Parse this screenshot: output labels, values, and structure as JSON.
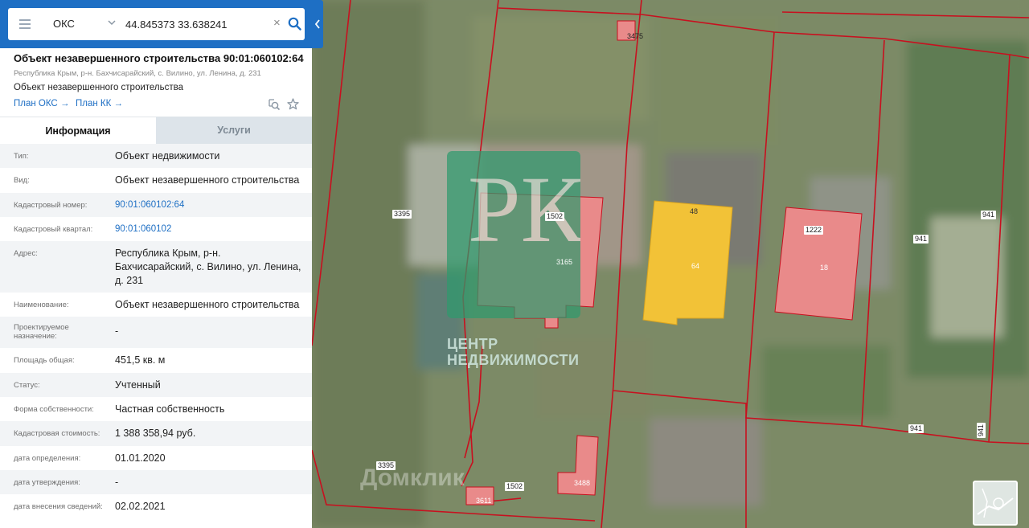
{
  "search": {
    "type_label": "ОКС",
    "query_value": "44.845373 33.638241",
    "clear_glyph": "×"
  },
  "object": {
    "title": "Объект незавершенного строительства 90:01:060102:64",
    "address_line": "Республика Крым, р-н. Бахчисарайский, с. Вилино, ул. Ленина, д. 231",
    "type_line": "Объект незавершенного строительства",
    "links": {
      "plan_oks": "План ОКС",
      "plan_kk": "План КК",
      "arrow": "→"
    }
  },
  "tabs": [
    {
      "label": "Информация",
      "active": true
    },
    {
      "label": "Услуги",
      "active": false
    }
  ],
  "info_rows": [
    {
      "key": "Тип:",
      "value": "Объект недвижимости"
    },
    {
      "key": "Вид:",
      "value": "Объект незавершенного строительства"
    },
    {
      "key": "Кадастровый номер:",
      "value": "90:01:060102:64",
      "link": true
    },
    {
      "key": "Кадастровый квартал:",
      "value": "90:01:060102",
      "link": true
    },
    {
      "key": "Адрес:",
      "value": "Республика Крым, р-н. Бахчисарайский, с. Вилино, ул. Ленина, д. 231"
    },
    {
      "key": "Наименование:",
      "value": "Объект незавершенного строительства"
    },
    {
      "key": "Проектируемое назначение:",
      "value": "-"
    },
    {
      "key": "Площадь общая:",
      "value": "451,5 кв. м"
    },
    {
      "key": "Статус:",
      "value": "Учтенный"
    },
    {
      "key": "Форма собственности:",
      "value": "Частная собственность"
    },
    {
      "key": "Кадастровая стоимость:",
      "value": "1 388 358,94 руб."
    },
    {
      "key": "дата определения:",
      "value": "01.01.2020"
    },
    {
      "key": "дата утверждения:",
      "value": "-"
    },
    {
      "key": "дата внесения сведений:",
      "value": "02.02.2021"
    }
  ],
  "map": {
    "parcel_labels": [
      "3395",
      "3395",
      "3475",
      "1502",
      "3165",
      "48",
      "64",
      "1222",
      "18",
      "941",
      "941",
      "941",
      "941",
      "1502",
      "3488",
      "3611"
    ],
    "watermark": {
      "logo_letters": "РК",
      "line1": "ЦЕНТР",
      "line2": "НЕДВИЖИМОСТИ",
      "domclick": "Домклик"
    }
  },
  "colors": {
    "accent": "#1e6fc4",
    "parcel_border": "#c8101f",
    "building_pink": "#e98a8a",
    "building_selected": "#f2c237"
  },
  "icons": [
    "menu-icon",
    "chevron-down-icon",
    "clear-icon",
    "search-icon",
    "zoom-icon",
    "star-icon",
    "chevron-left-icon"
  ]
}
